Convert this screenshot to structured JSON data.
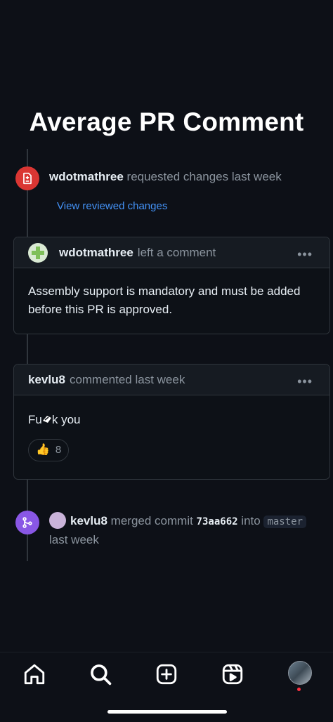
{
  "page": {
    "title": "Average PR Comment"
  },
  "timeline": {
    "review_event": {
      "user": "wdotmathree",
      "action": "requested changes last week",
      "link": "View reviewed changes",
      "icon": "file-diff-icon",
      "color": "#da3633"
    },
    "review_comment": {
      "user": "wdotmathree",
      "action": "left a comment",
      "body": "Assembly support is mandatory and must be added before this PR is approved.",
      "menu": "•••"
    },
    "comment": {
      "user": "kevlu8",
      "action": "commented last week",
      "body_prefix": "Fu",
      "body_suffix": "k you",
      "reaction_emoji": "👍",
      "reaction_count": "8",
      "menu": "•••"
    },
    "merge_event": {
      "user": "kevlu8",
      "action": "merged commit",
      "sha": "73aa662",
      "into": "into",
      "branch": "master",
      "time": "last week",
      "icon": "git-merge-icon",
      "color": "#8957e5"
    }
  },
  "tabbar": {
    "items": [
      "home-icon",
      "search-icon",
      "create-icon",
      "reels-icon",
      "profile-avatar"
    ],
    "notification_dot_color": "#ff3040"
  }
}
